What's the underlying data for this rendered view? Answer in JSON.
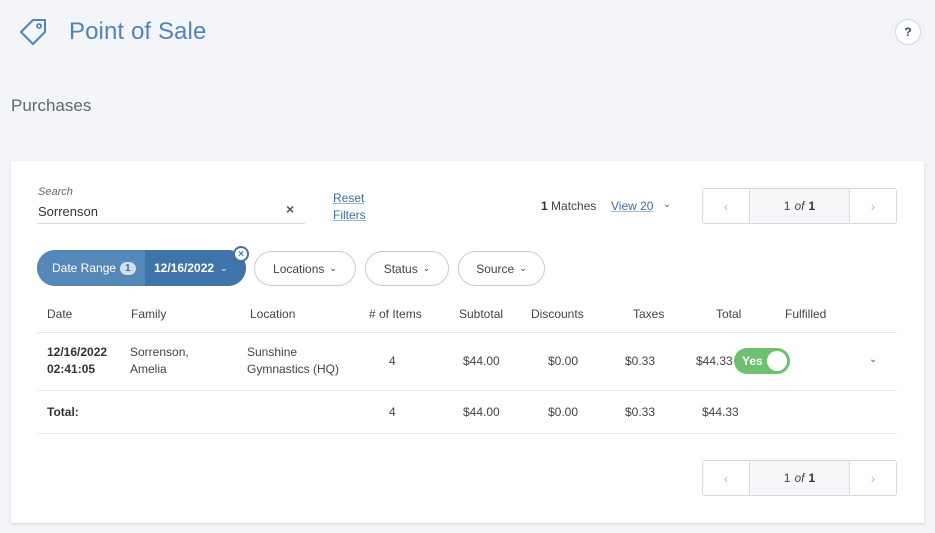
{
  "header": {
    "title": "Point of Sale",
    "help_label": "?"
  },
  "section": {
    "title": "Purchases"
  },
  "search": {
    "label": "Search",
    "value": "Sorrenson",
    "clear_label": "×"
  },
  "reset_filters": {
    "line1": "Reset",
    "line2": "Filters"
  },
  "results": {
    "count": "1",
    "matches_label": "Matches",
    "view_label": "View 20"
  },
  "pager_top": {
    "current": "1",
    "of_label": "of",
    "total": "1"
  },
  "pager_bottom": {
    "current": "1",
    "of_label": "of",
    "total": "1"
  },
  "filters": {
    "date_range": {
      "label": "Date Range",
      "badge": "1",
      "value": "12/16/2022",
      "close_label": "×"
    },
    "locations": "Locations",
    "status": "Status",
    "source": "Source"
  },
  "table": {
    "headers": [
      "Date",
      "Family",
      "Location",
      "# of Items",
      "Subtotal",
      "Discounts",
      "Taxes",
      "Total",
      "Fulfilled"
    ],
    "rows": [
      {
        "date_line1": "12/16/2022",
        "date_line2": "02:41:05",
        "family_line1": "Sorrenson,",
        "family_line2": "Amelia",
        "location_line1": "Sunshine",
        "location_line2": "Gymnastics (HQ)",
        "items": "4",
        "subtotal": "$44.00",
        "discounts": "$0.00",
        "taxes": "$0.33",
        "total": "$44.33",
        "fulfilled": "Yes"
      }
    ],
    "totals": {
      "label": "Total:",
      "items": "4",
      "subtotal": "$44.00",
      "discounts": "$0.00",
      "taxes": "$0.33",
      "total": "$44.33"
    }
  },
  "colors": {
    "accent": "#4f86b8",
    "pill_active": "#3f74a8",
    "toggle_on": "#6cc070"
  },
  "icons": {
    "app": "tag-icon",
    "prev": "chevron-left-icon",
    "next": "chevron-right-icon",
    "expand": "chevron-down-icon"
  }
}
